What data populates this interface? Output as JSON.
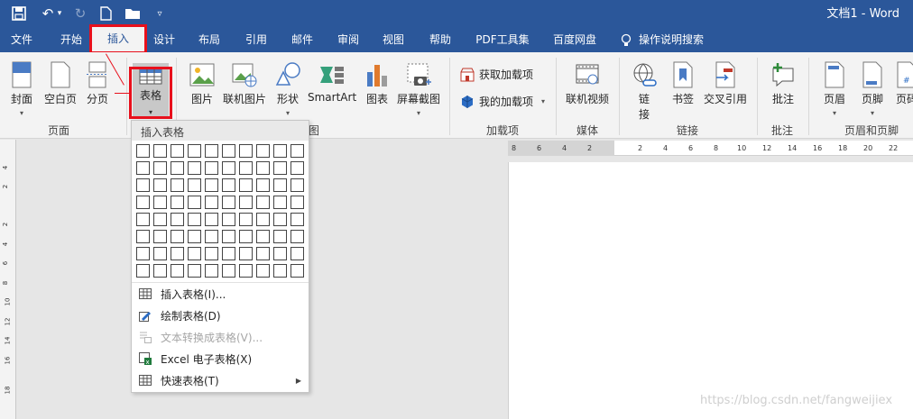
{
  "titlebar": {
    "title": "文档1 - Word"
  },
  "tabs": [
    "文件",
    "开始",
    "插入",
    "设计",
    "布局",
    "引用",
    "邮件",
    "审阅",
    "视图",
    "帮助",
    "PDF工具集",
    "百度网盘",
    "操作说明搜索"
  ],
  "ribbon": {
    "pages": {
      "cover": "封面",
      "blank": "空白页",
      "break": "分页",
      "group": "页面"
    },
    "table": {
      "label": "表格"
    },
    "illustrations": {
      "picture": "图片",
      "online_picture": "联机图片",
      "shapes": "形状",
      "smartart": "SmartArt",
      "chart": "图表",
      "screenshot": "屏幕截图",
      "group": "图"
    },
    "addins": {
      "get": "获取加载项",
      "mine": "我的加载项",
      "group": "加载项"
    },
    "media": {
      "online_video": "联机视频",
      "group": "媒体"
    },
    "links": {
      "link_line1": "链",
      "link_line2": "接",
      "bookmark": "书签",
      "crossref": "交叉引用",
      "group": "链接"
    },
    "comments": {
      "comment": "批注",
      "group": "批注"
    },
    "headerfooter": {
      "header": "页眉",
      "footer": "页脚",
      "pagenum": "页码",
      "group": "页眉和页脚"
    }
  },
  "table_menu": {
    "header": "插入表格",
    "items": [
      "插入表格(I)...",
      "绘制表格(D)",
      "文本转换成表格(V)...",
      "Excel 电子表格(X)",
      "快速表格(T)"
    ]
  },
  "hruler_ticks": [
    "8",
    "6",
    "4",
    "2",
    "2",
    "4",
    "6",
    "8",
    "10",
    "12",
    "14",
    "16",
    "18",
    "20",
    "22"
  ],
  "vruler_ticks": [
    "4",
    "2",
    "2",
    "4",
    "6",
    "8",
    "10",
    "12",
    "14",
    "16",
    "18"
  ],
  "watermark": "https://blog.csdn.net/fangweijiex"
}
